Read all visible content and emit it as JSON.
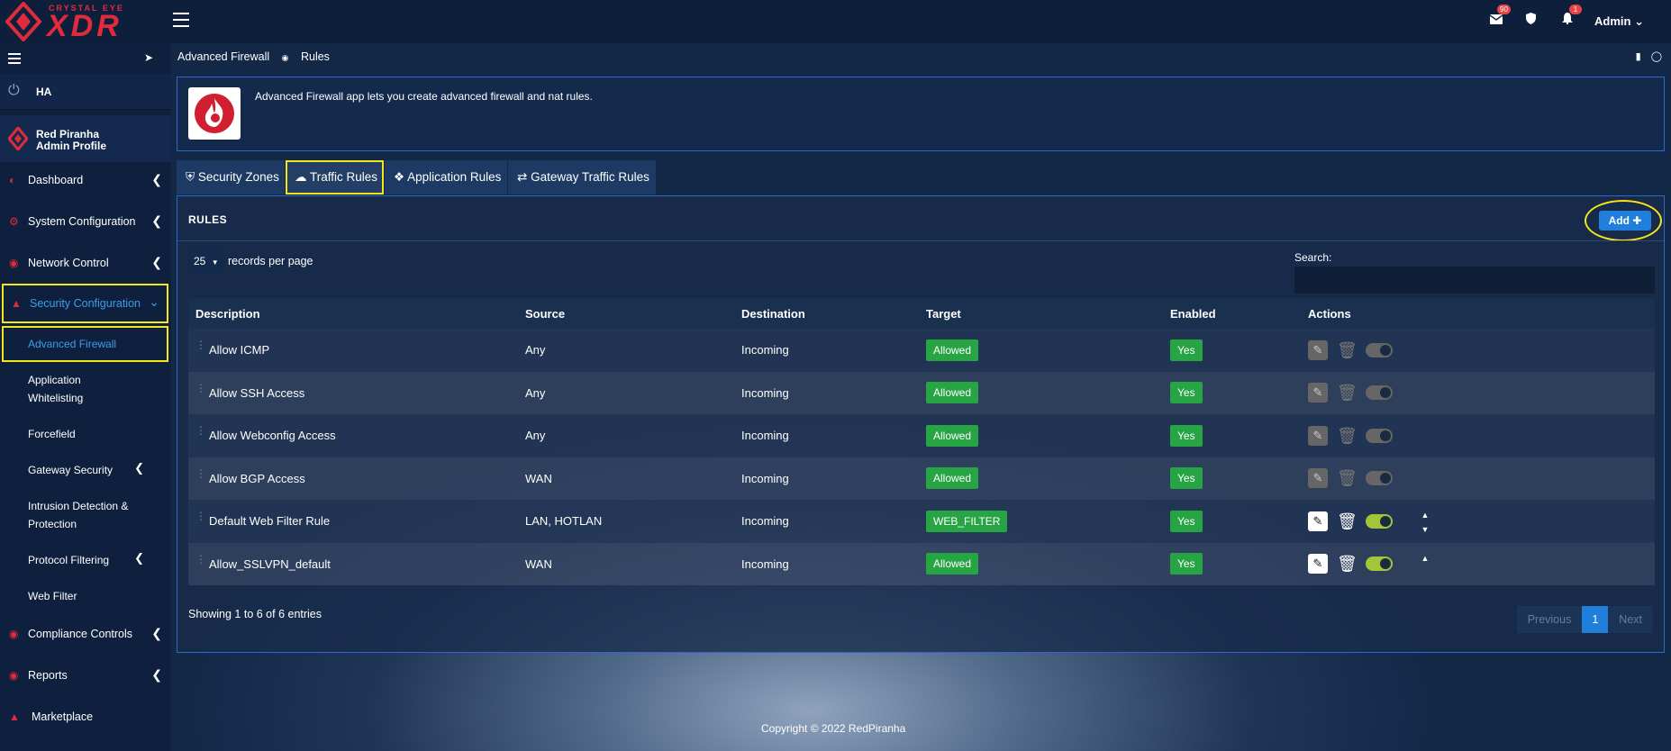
{
  "brand": {
    "sub": "CRYSTAL EYE",
    "main": "XDR"
  },
  "header": {
    "mail_count": "90",
    "notif_count": "1",
    "user": "Admin"
  },
  "sidebar": {
    "ha_label": "HA",
    "profile_name": "Red Piranha",
    "profile_role": "Admin Profile",
    "nav": [
      {
        "label": "Dashboard"
      },
      {
        "label": "System Configuration"
      },
      {
        "label": "Network Control"
      },
      {
        "label": "Security Configuration"
      },
      {
        "label": "Compliance Controls"
      },
      {
        "label": "Reports"
      },
      {
        "label": "Marketplace"
      }
    ],
    "sub": [
      {
        "label": "Advanced Firewall"
      },
      {
        "label": "Application Whitelisting"
      },
      {
        "label": "Forcefield"
      },
      {
        "label": "Gateway Security"
      },
      {
        "label": "Intrusion Detection & Protection"
      },
      {
        "label": "Protocol Filtering"
      },
      {
        "label": "Web Filter"
      }
    ]
  },
  "breadcrumb": {
    "parent": "Advanced Firewall",
    "current": "Rules"
  },
  "app": {
    "description": "Advanced Firewall app lets you create advanced firewall and nat rules."
  },
  "tabs": [
    {
      "label": "Security Zones",
      "icon": "shield-icon"
    },
    {
      "label": "Traffic Rules",
      "icon": "cloud-icon"
    },
    {
      "label": "Application Rules",
      "icon": "cubes-icon"
    },
    {
      "label": "Gateway Traffic Rules",
      "icon": "exchange-icon"
    }
  ],
  "rules": {
    "title": "RULES",
    "add_label": "Add",
    "page_length": "25",
    "page_length_label": "records per page",
    "search_label": "Search:",
    "search_value": "",
    "columns": [
      "Description",
      "Source",
      "Destination",
      "Target",
      "Enabled",
      "Actions"
    ],
    "rows": [
      {
        "description": "Allow ICMP",
        "source": "Any",
        "destination": "Incoming",
        "target": "Allowed",
        "enabled": "Yes",
        "editable": false
      },
      {
        "description": "Allow SSH Access",
        "source": "Any",
        "destination": "Incoming",
        "target": "Allowed",
        "enabled": "Yes",
        "editable": false
      },
      {
        "description": "Allow Webconfig Access",
        "source": "Any",
        "destination": "Incoming",
        "target": "Allowed",
        "enabled": "Yes",
        "editable": false
      },
      {
        "description": "Allow BGP Access",
        "source": "WAN",
        "destination": "Incoming",
        "target": "Allowed",
        "enabled": "Yes",
        "editable": false
      },
      {
        "description": "Default Web Filter Rule",
        "source": "LAN, HOTLAN",
        "destination": "Incoming",
        "target": "WEB_FILTER",
        "enabled": "Yes",
        "editable": true
      },
      {
        "description": "Allow_SSLVPN_default",
        "source": "WAN",
        "destination": "Incoming",
        "target": "Allowed",
        "enabled": "Yes",
        "editable": true
      }
    ],
    "info": "Showing 1 to 6 of 6 entries",
    "pager": {
      "previous": "Previous",
      "current": "1",
      "next": "Next"
    }
  },
  "footer": "Copyright © 2022 RedPiranha",
  "colors": {
    "accent": "#1f7fdb",
    "success": "#27a443",
    "brand_red": "#e02b3d",
    "highlight": "#f5e61a"
  }
}
